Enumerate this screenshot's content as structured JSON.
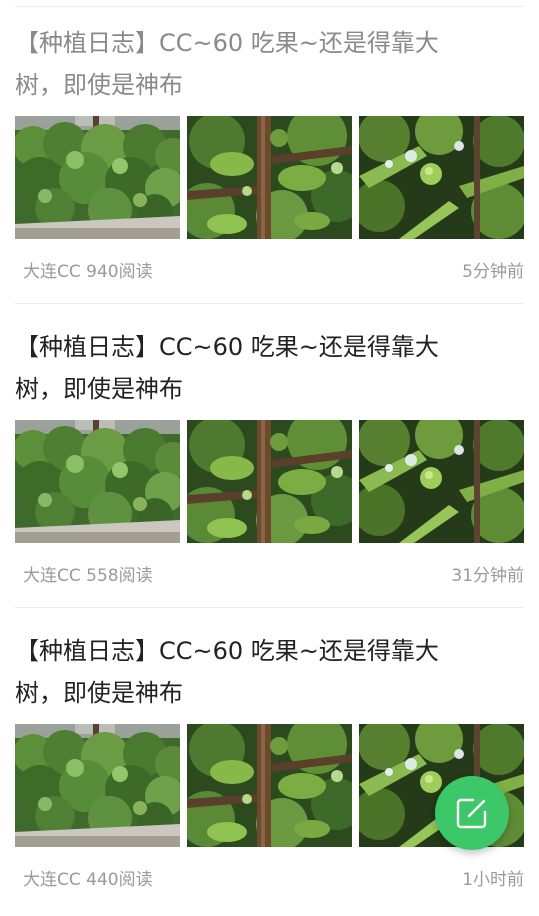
{
  "posts": [
    {
      "title": "【种植日志】CC~60 吃果~还是得靠大树，即使是神布",
      "author_views": "大连CC 940阅读",
      "time": "5分钟前",
      "read": true,
      "images": [
        "bush-photo",
        "fig-branch-photo",
        "fig-fruit-photo"
      ]
    },
    {
      "title": "【种植日志】CC~60 吃果~还是得靠大树，即使是神布",
      "author_views": "大连CC 558阅读",
      "time": "31分钟前",
      "read": false,
      "images": [
        "bush-photo",
        "fig-branch-photo",
        "fig-fruit-photo"
      ]
    },
    {
      "title": "【种植日志】CC~60 吃果~还是得靠大树，即使是神布",
      "author_views": "大连CC 440阅读",
      "time": "1小时前",
      "read": false,
      "images": [
        "bush-photo",
        "fig-branch-photo",
        "fig-fruit-photo"
      ]
    }
  ],
  "fab": {
    "icon": "compose-icon",
    "color": "#3cc768"
  },
  "colors": {
    "title_unread": "#222222",
    "title_read": "#8a8a8a",
    "meta": "#9a9a9a",
    "divider": "#ececec"
  }
}
